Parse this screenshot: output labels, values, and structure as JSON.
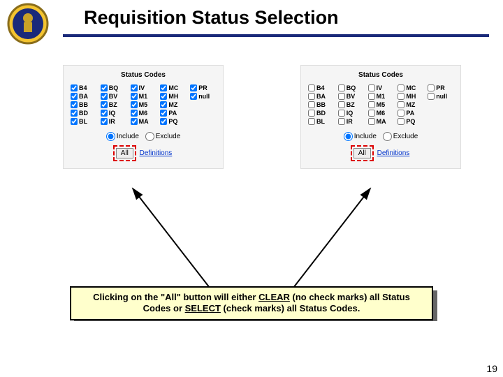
{
  "header": {
    "title": "Requisition Status Selection"
  },
  "panel_title": "Status Codes",
  "codes": [
    "B4",
    "BQ",
    "IV",
    "MC",
    "PR",
    "BA",
    "BV",
    "M1",
    "MH",
    "null",
    "BB",
    "BZ",
    "M5",
    "MZ",
    "",
    "BD",
    "IQ",
    "M6",
    "PA",
    "",
    "BL",
    "IR",
    "MA",
    "PQ",
    ""
  ],
  "radios": {
    "include": "Include",
    "exclude": "Exclude"
  },
  "buttons": {
    "all": "All",
    "definitions": "Definitions"
  },
  "callout": {
    "prefix": "Clicking on the \"All\" button will either ",
    "u1": "CLEAR",
    "mid1": " (no check marks) all Status Codes or ",
    "u2": "SELECT",
    "suffix": " (check marks) all Status Codes."
  },
  "page_number": "19"
}
